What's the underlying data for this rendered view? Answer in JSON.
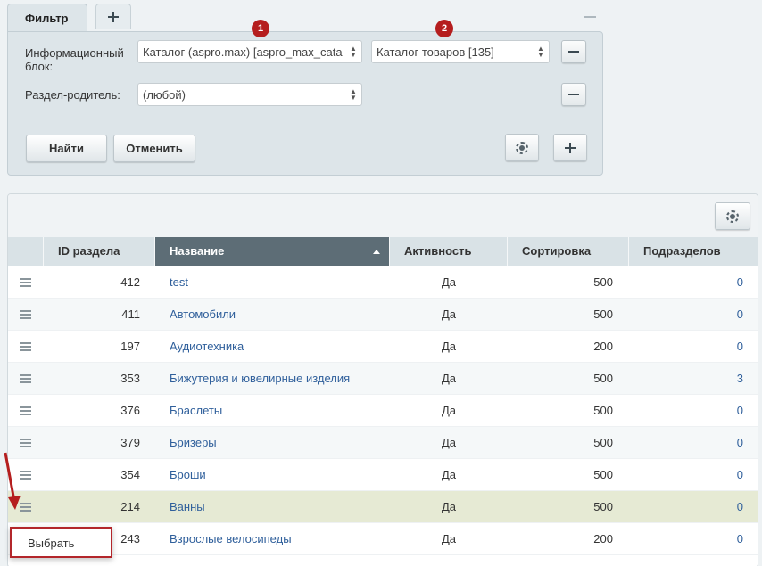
{
  "filter": {
    "tab_label": "Фильтр",
    "iblock_label": "Информационный блок:",
    "iblock_type_value": "Каталог (aspro.max) [aspro_max_cata",
    "iblock_value": "Каталог товаров [135]",
    "parent_label": "Раздел-родитель:",
    "parent_value": "(любой)",
    "find_label": "Найти",
    "cancel_label": "Отменить",
    "badges": [
      "1",
      "2"
    ]
  },
  "grid": {
    "columns": [
      "ID раздела",
      "Название",
      "Активность",
      "Сортировка",
      "Подразделов"
    ],
    "sorted_column": "Название",
    "rows": [
      {
        "id": "412",
        "name": "test",
        "active": "Да",
        "sort": "500",
        "sub": "0"
      },
      {
        "id": "411",
        "name": "Автомобили",
        "active": "Да",
        "sort": "500",
        "sub": "0"
      },
      {
        "id": "197",
        "name": "Аудиотехника",
        "active": "Да",
        "sort": "200",
        "sub": "0"
      },
      {
        "id": "353",
        "name": "Бижутерия и ювелирные изделия",
        "active": "Да",
        "sort": "500",
        "sub": "3"
      },
      {
        "id": "376",
        "name": "Браслеты",
        "active": "Да",
        "sort": "500",
        "sub": "0"
      },
      {
        "id": "379",
        "name": "Бризеры",
        "active": "Да",
        "sort": "500",
        "sub": "0"
      },
      {
        "id": "354",
        "name": "Броши",
        "active": "Да",
        "sort": "500",
        "sub": "0"
      },
      {
        "id": "214",
        "name": "Ванны",
        "active": "Да",
        "sort": "500",
        "sub": "0"
      },
      {
        "id": "243",
        "name": "Взрослые велосипеды",
        "active": "Да",
        "sort": "200",
        "sub": "0"
      }
    ],
    "highlighted_row": "214"
  },
  "popup": {
    "select_label": "Выбрать"
  },
  "colors": {
    "accent_red": "#b51e1e",
    "link": "#2f5f9b",
    "header_sorted": "#5d6d76"
  }
}
